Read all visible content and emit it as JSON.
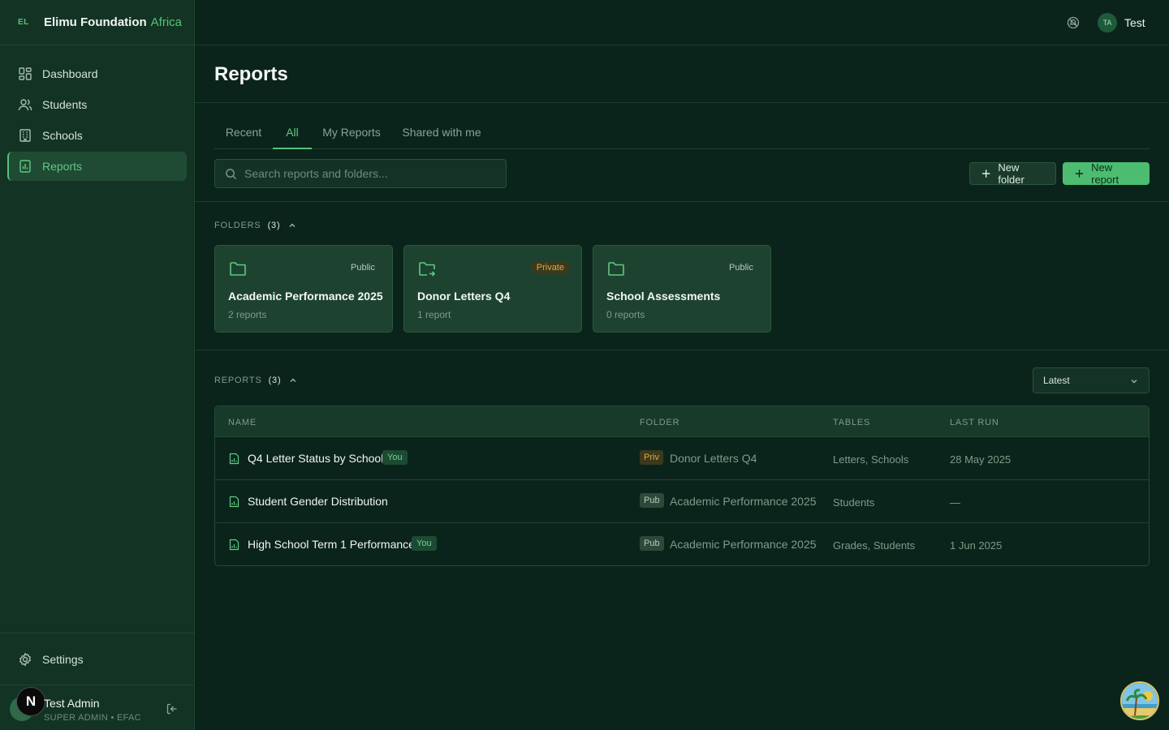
{
  "brand": {
    "mark": "EL",
    "name": "Elimu Foundation",
    "accent": "Africa"
  },
  "sidebar": {
    "items": [
      {
        "label": "Dashboard",
        "icon": "dashboard-icon"
      },
      {
        "label": "Students",
        "icon": "students-icon"
      },
      {
        "label": "Schools",
        "icon": "schools-icon"
      },
      {
        "label": "Reports",
        "icon": "reports-icon",
        "active": true
      }
    ],
    "settings_label": "Settings",
    "user": {
      "name": "Test Admin",
      "role": "SUPER ADMIN • EFAC",
      "badge": "N"
    }
  },
  "topbar": {
    "avatar_initials": "TA",
    "user_name": "Test"
  },
  "page": {
    "title": "Reports"
  },
  "tabs": [
    {
      "label": "Recent"
    },
    {
      "label": "All",
      "active": true
    },
    {
      "label": "My Reports"
    },
    {
      "label": "Shared with me"
    }
  ],
  "search": {
    "placeholder": "Search reports and folders...",
    "value": ""
  },
  "actions": {
    "new_folder": "New folder",
    "new_report": "New report"
  },
  "folders": {
    "heading": "FOLDERS",
    "count": "(3)",
    "items": [
      {
        "name": "Academic Performance 2025",
        "meta": "2 reports",
        "visibility": "Public"
      },
      {
        "name": "Donor Letters Q4",
        "meta": "1 report",
        "visibility": "Private"
      },
      {
        "name": "School Assessments",
        "meta": "0 reports",
        "visibility": "Public"
      }
    ]
  },
  "reports": {
    "heading": "REPORTS",
    "count": "(3)",
    "sort": {
      "selected": "Latest"
    },
    "columns": {
      "name": "NAME",
      "folder": "FOLDER",
      "tables": "TABLES",
      "last_run": "LAST RUN"
    },
    "rows": [
      {
        "name": "Q4 Letter Status by School",
        "owner_badge": "You",
        "visibility": "Priv",
        "folder": "Donor Letters Q4",
        "tables": "Letters, Schools",
        "last_run": "28 May 2025"
      },
      {
        "name": "Student Gender Distribution",
        "owner_badge": "",
        "visibility": "Pub",
        "folder": "Academic Performance 2025",
        "tables": "Students",
        "last_run": "—"
      },
      {
        "name": "High School Term 1 Performance",
        "owner_badge": "You",
        "visibility": "Pub",
        "folder": "Academic Performance 2025",
        "tables": "Grades, Students",
        "last_run": "1 Jun 2025"
      }
    ]
  },
  "colors": {
    "accent": "#57c27a",
    "background": "#0b241b",
    "sidebar": "#133424",
    "private": "#e0a840"
  }
}
